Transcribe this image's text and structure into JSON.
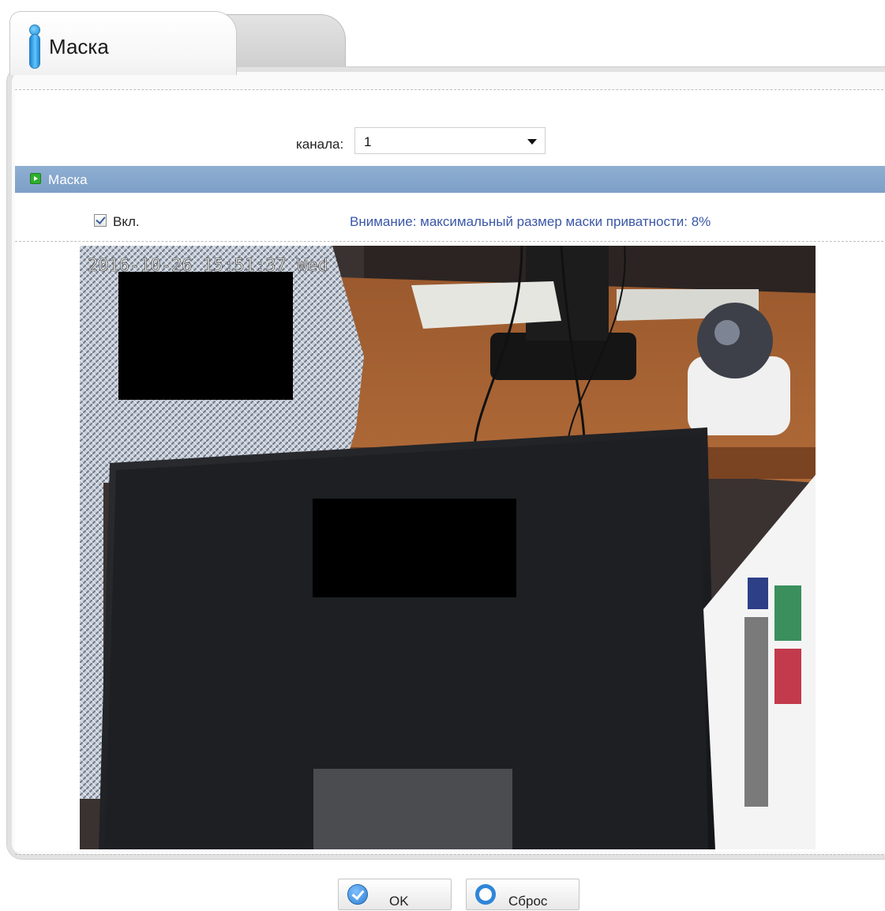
{
  "tabs": [
    {
      "label": "Маска",
      "active": true
    },
    {
      "label": "",
      "active": false
    }
  ],
  "channel": {
    "label": "канала:",
    "value": "1"
  },
  "section": {
    "title": "Маска"
  },
  "enable": {
    "label": "Вкл.",
    "checked": true
  },
  "notice": "Внимание: максимальный размер маски приватности: 8%",
  "video": {
    "timestamp": "2016-10-26 15:51:37 Wed",
    "privacy_mask_count": 2
  },
  "buttons": {
    "ok_label": "OK",
    "reset_label": "Сброс"
  },
  "colors": {
    "section_header": "#7f9fc7",
    "notice_text": "#3a57a8",
    "ok_icon": "#2f7fd0",
    "reset_icon": "#2f86d8"
  }
}
